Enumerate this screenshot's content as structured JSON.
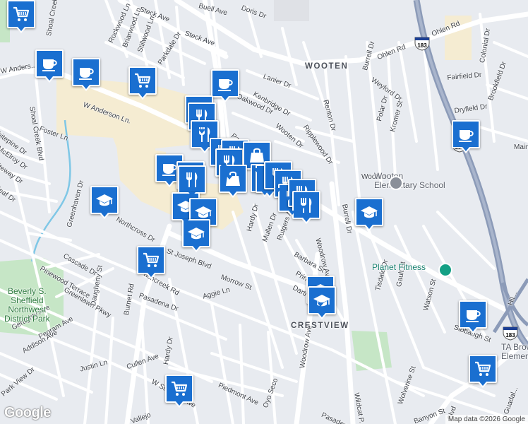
{
  "map": {
    "attribution": "Map data ©2026 Google",
    "logo": "Google",
    "colors": {
      "road": "#ffffff",
      "land": "#e8ebf0",
      "highway": "#8c9bb8",
      "park": "#c6e6c6",
      "commercial": "#f5ecd2",
      "pin": "#1a6fd0"
    },
    "areas": [
      {
        "name": "wooten-area-label",
        "text": "WOOTEN",
        "style": "big"
      },
      {
        "name": "crestview-area-label",
        "text": "CRESTVIEW",
        "style": "big"
      }
    ],
    "streets": [
      {
        "text": "Doris Dr"
      },
      {
        "text": "Buell Ave"
      },
      {
        "text": "Steck Ave"
      },
      {
        "text": "Steck Ave"
      },
      {
        "text": "Rockwood Ln"
      },
      {
        "text": "Briarwood Ln"
      },
      {
        "text": "Stillwood Ln"
      },
      {
        "text": "Parkdale Dr"
      },
      {
        "text": "Shoal Creek"
      },
      {
        "text": "W Anders..."
      },
      {
        "text": "Lanier Dr"
      },
      {
        "text": "Kenbridge Dr"
      },
      {
        "text": "Oakwood Dr"
      },
      {
        "text": "Ohlen Rd"
      },
      {
        "text": "Ohlen Rd"
      },
      {
        "text": "Colonial Dr"
      },
      {
        "text": "Burrell Dr"
      },
      {
        "text": "Weyford Dr"
      },
      {
        "text": "Fairfield Dr"
      },
      {
        "text": "Dryfield Dr"
      },
      {
        "text": "Brookfield Dr"
      },
      {
        "text": "Maine"
      },
      {
        "text": "Polar Dr"
      },
      {
        "text": "Kromer St"
      },
      {
        "text": "Renton Dr"
      },
      {
        "text": "Ripplewood Dr"
      },
      {
        "text": "Wooten Dr"
      },
      {
        "text": "Pompton Dr"
      },
      {
        "text": "W Anderson Ln."
      },
      {
        "text": "Shoal Creek Blvd"
      },
      {
        "text": "Foster Ln"
      },
      {
        "text": "hitepine Dr"
      },
      {
        "text": "McElroy Dr"
      },
      {
        "text": "iteway Dr"
      },
      {
        "text": "leaf Dr"
      },
      {
        "text": "Greenhaven Dr"
      },
      {
        "text": "Northcross Dr"
      },
      {
        "text": "St Joseph Blvd"
      },
      {
        "text": "Cascade Dr"
      },
      {
        "text": "Pinewood Terrace"
      },
      {
        "text": "Greenlawn Pkwy"
      },
      {
        "text": "Burnet Rd"
      },
      {
        "text": "nchcreek Rd"
      },
      {
        "text": "Pasadena Dr"
      },
      {
        "text": "Morrow St"
      },
      {
        "text": "Aggie Ln"
      },
      {
        "text": "Hardy Dr"
      },
      {
        "text": "Mullen Dr"
      },
      {
        "text": "Rutgers Ave"
      },
      {
        "text": "Barbara St"
      },
      {
        "text": "Princeto..."
      },
      {
        "text": "Dartmou..."
      },
      {
        "text": "Woodrow Ave"
      },
      {
        "text": "Woodrow Ave"
      },
      {
        "text": "Burrell Dr"
      },
      {
        "text": "Tisdale Dr"
      },
      {
        "text": "Gault St"
      },
      {
        "text": "Watson St"
      },
      {
        "text": "Stobaugh St"
      },
      {
        "text": "Daugherty St"
      },
      {
        "text": "Geraghty Ave"
      },
      {
        "text": "Pegram Ave"
      },
      {
        "text": "Addison Ave"
      },
      {
        "text": "Park View Dr"
      },
      {
        "text": "Justin Ln"
      },
      {
        "text": "Cullen Ave"
      },
      {
        "text": "W St Johns Ave"
      },
      {
        "text": "Hardy Dr"
      },
      {
        "text": "Piedmont Ave"
      },
      {
        "text": "Vallejo"
      },
      {
        "text": "Oyo Seco"
      },
      {
        "text": "Pasadena Dr"
      },
      {
        "text": "Wildcat P..."
      },
      {
        "text": "Wolverine St"
      },
      {
        "text": "Banyon St"
      },
      {
        "text": "Blvd"
      },
      {
        "text": "Guadal..."
      },
      {
        "text": "Hil..."
      },
      {
        "text": "Wooten"
      }
    ],
    "places": [
      {
        "name": "wooten-elementary-label",
        "text": "Wooten\nElementary School",
        "style": "sch"
      },
      {
        "name": "planet-fitness-label",
        "text": "Planet Fitness",
        "style": "poi"
      },
      {
        "name": "beverly-park-label",
        "text": "Beverly S.\nSheffield\nNorthwest\nDistrict Park",
        "style": "park"
      },
      {
        "name": "ta-brown-label",
        "text": "TA Brow\nElementary Schoo",
        "style": "sch"
      }
    ],
    "highway_shields": [
      "183",
      "183",
      "183"
    ],
    "markers": [
      {
        "icon": "cart"
      },
      {
        "icon": "coffee"
      },
      {
        "icon": "coffee"
      },
      {
        "icon": "cart"
      },
      {
        "icon": "coffee"
      },
      {
        "icon": "utensils"
      },
      {
        "icon": "utensils"
      },
      {
        "icon": "utensils"
      },
      {
        "icon": "utensils"
      },
      {
        "icon": "utensils"
      },
      {
        "icon": "utensils"
      },
      {
        "icon": "bag"
      },
      {
        "icon": "coffee"
      },
      {
        "icon": "utensils"
      },
      {
        "icon": "utensils"
      },
      {
        "icon": "bag"
      },
      {
        "icon": "utensils"
      },
      {
        "icon": "utensils"
      },
      {
        "icon": "utensils"
      },
      {
        "icon": "utensils"
      },
      {
        "icon": "utensils"
      },
      {
        "icon": "utensils"
      },
      {
        "icon": "utensils"
      },
      {
        "icon": "school"
      },
      {
        "icon": "school"
      },
      {
        "icon": "school"
      },
      {
        "icon": "school"
      },
      {
        "icon": "school"
      },
      {
        "icon": "cart"
      },
      {
        "icon": "school"
      },
      {
        "icon": "school"
      },
      {
        "icon": "coffee"
      },
      {
        "icon": "cart"
      },
      {
        "icon": "cart"
      },
      {
        "icon": "coffee"
      }
    ]
  }
}
